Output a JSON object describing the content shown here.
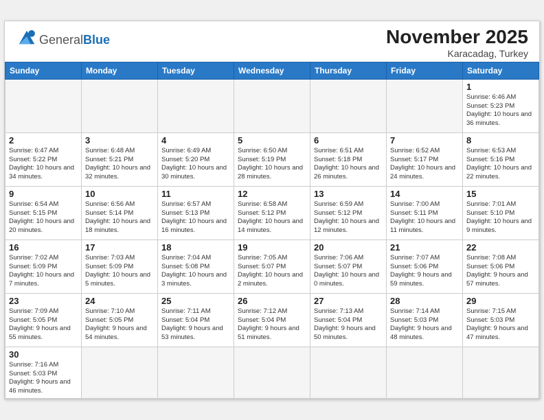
{
  "header": {
    "logo_general": "General",
    "logo_blue": "Blue",
    "month_title": "November 2025",
    "location": "Karacadag, Turkey"
  },
  "weekdays": [
    "Sunday",
    "Monday",
    "Tuesday",
    "Wednesday",
    "Thursday",
    "Friday",
    "Saturday"
  ],
  "days": [
    {
      "num": "",
      "info": ""
    },
    {
      "num": "",
      "info": ""
    },
    {
      "num": "",
      "info": ""
    },
    {
      "num": "",
      "info": ""
    },
    {
      "num": "",
      "info": ""
    },
    {
      "num": "",
      "info": ""
    },
    {
      "num": "1",
      "info": "Sunrise: 6:46 AM\nSunset: 5:23 PM\nDaylight: 10 hours\nand 36 minutes."
    },
    {
      "num": "2",
      "info": "Sunrise: 6:47 AM\nSunset: 5:22 PM\nDaylight: 10 hours\nand 34 minutes."
    },
    {
      "num": "3",
      "info": "Sunrise: 6:48 AM\nSunset: 5:21 PM\nDaylight: 10 hours\nand 32 minutes."
    },
    {
      "num": "4",
      "info": "Sunrise: 6:49 AM\nSunset: 5:20 PM\nDaylight: 10 hours\nand 30 minutes."
    },
    {
      "num": "5",
      "info": "Sunrise: 6:50 AM\nSunset: 5:19 PM\nDaylight: 10 hours\nand 28 minutes."
    },
    {
      "num": "6",
      "info": "Sunrise: 6:51 AM\nSunset: 5:18 PM\nDaylight: 10 hours\nand 26 minutes."
    },
    {
      "num": "7",
      "info": "Sunrise: 6:52 AM\nSunset: 5:17 PM\nDaylight: 10 hours\nand 24 minutes."
    },
    {
      "num": "8",
      "info": "Sunrise: 6:53 AM\nSunset: 5:16 PM\nDaylight: 10 hours\nand 22 minutes."
    },
    {
      "num": "9",
      "info": "Sunrise: 6:54 AM\nSunset: 5:15 PM\nDaylight: 10 hours\nand 20 minutes."
    },
    {
      "num": "10",
      "info": "Sunrise: 6:56 AM\nSunset: 5:14 PM\nDaylight: 10 hours\nand 18 minutes."
    },
    {
      "num": "11",
      "info": "Sunrise: 6:57 AM\nSunset: 5:13 PM\nDaylight: 10 hours\nand 16 minutes."
    },
    {
      "num": "12",
      "info": "Sunrise: 6:58 AM\nSunset: 5:12 PM\nDaylight: 10 hours\nand 14 minutes."
    },
    {
      "num": "13",
      "info": "Sunrise: 6:59 AM\nSunset: 5:12 PM\nDaylight: 10 hours\nand 12 minutes."
    },
    {
      "num": "14",
      "info": "Sunrise: 7:00 AM\nSunset: 5:11 PM\nDaylight: 10 hours\nand 11 minutes."
    },
    {
      "num": "15",
      "info": "Sunrise: 7:01 AM\nSunset: 5:10 PM\nDaylight: 10 hours\nand 9 minutes."
    },
    {
      "num": "16",
      "info": "Sunrise: 7:02 AM\nSunset: 5:09 PM\nDaylight: 10 hours\nand 7 minutes."
    },
    {
      "num": "17",
      "info": "Sunrise: 7:03 AM\nSunset: 5:09 PM\nDaylight: 10 hours\nand 5 minutes."
    },
    {
      "num": "18",
      "info": "Sunrise: 7:04 AM\nSunset: 5:08 PM\nDaylight: 10 hours\nand 3 minutes."
    },
    {
      "num": "19",
      "info": "Sunrise: 7:05 AM\nSunset: 5:07 PM\nDaylight: 10 hours\nand 2 minutes."
    },
    {
      "num": "20",
      "info": "Sunrise: 7:06 AM\nSunset: 5:07 PM\nDaylight: 10 hours\nand 0 minutes."
    },
    {
      "num": "21",
      "info": "Sunrise: 7:07 AM\nSunset: 5:06 PM\nDaylight: 9 hours\nand 59 minutes."
    },
    {
      "num": "22",
      "info": "Sunrise: 7:08 AM\nSunset: 5:06 PM\nDaylight: 9 hours\nand 57 minutes."
    },
    {
      "num": "23",
      "info": "Sunrise: 7:09 AM\nSunset: 5:05 PM\nDaylight: 9 hours\nand 55 minutes."
    },
    {
      "num": "24",
      "info": "Sunrise: 7:10 AM\nSunset: 5:05 PM\nDaylight: 9 hours\nand 54 minutes."
    },
    {
      "num": "25",
      "info": "Sunrise: 7:11 AM\nSunset: 5:04 PM\nDaylight: 9 hours\nand 53 minutes."
    },
    {
      "num": "26",
      "info": "Sunrise: 7:12 AM\nSunset: 5:04 PM\nDaylight: 9 hours\nand 51 minutes."
    },
    {
      "num": "27",
      "info": "Sunrise: 7:13 AM\nSunset: 5:04 PM\nDaylight: 9 hours\nand 50 minutes."
    },
    {
      "num": "28",
      "info": "Sunrise: 7:14 AM\nSunset: 5:03 PM\nDaylight: 9 hours\nand 48 minutes."
    },
    {
      "num": "29",
      "info": "Sunrise: 7:15 AM\nSunset: 5:03 PM\nDaylight: 9 hours\nand 47 minutes."
    },
    {
      "num": "30",
      "info": "Sunrise: 7:16 AM\nSunset: 5:03 PM\nDaylight: 9 hours\nand 46 minutes."
    },
    {
      "num": "",
      "info": ""
    },
    {
      "num": "",
      "info": ""
    },
    {
      "num": "",
      "info": ""
    },
    {
      "num": "",
      "info": ""
    },
    {
      "num": "",
      "info": ""
    },
    {
      "num": "",
      "info": ""
    }
  ]
}
